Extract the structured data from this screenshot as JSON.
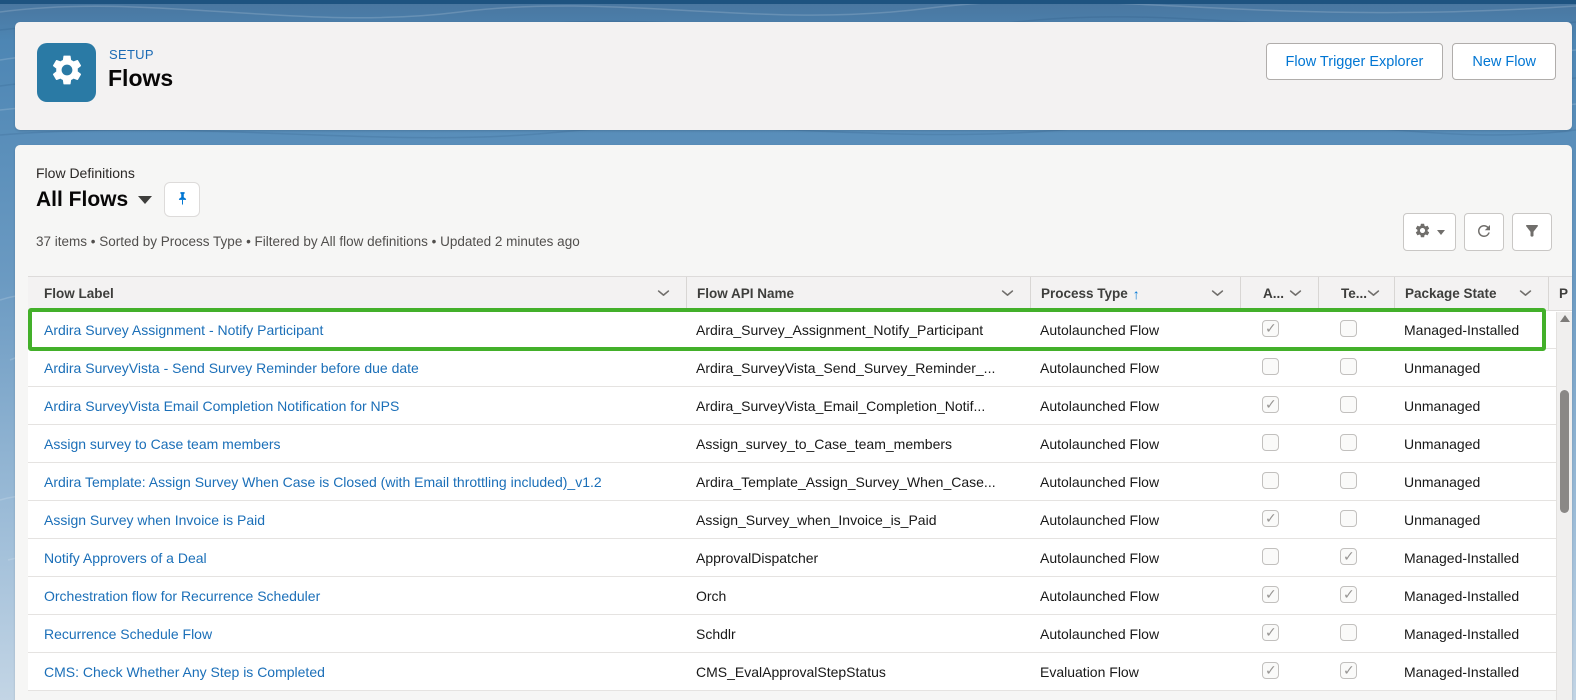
{
  "colors": {
    "tile": "#2a7aa5",
    "setuplabel": "#1b6bb5",
    "link": "#1b6fb8",
    "btn": "#0176d3",
    "green": "#43b02a"
  },
  "header": {
    "setup_label": "SETUP",
    "title": "Flows",
    "buttons": [
      {
        "label": "Flow Trigger Explorer"
      },
      {
        "label": "New Flow"
      }
    ],
    "icons": {
      "tile": "gear-icon"
    }
  },
  "list_header": {
    "entity_label": "Flow Definitions",
    "view_name": "All Flows",
    "status_text": "37 items • Sorted by Process Type • Filtered by All flow definitions • Updated 2 minutes ago",
    "icons": {
      "view_caret": "chevron-down-icon",
      "pin": "pin-icon",
      "settings": "gear-icon",
      "refresh": "refresh-icon",
      "filter": "filter-icon"
    }
  },
  "table": {
    "columns": [
      {
        "label": "Flow Label"
      },
      {
        "label": "Flow API Name"
      },
      {
        "label": "Process Type",
        "sorted": "ascending"
      },
      {
        "label": "A..."
      },
      {
        "label": "Te..."
      },
      {
        "label": "Package State"
      },
      {
        "label": "P",
        "clipped": true
      }
    ],
    "rows": [
      {
        "label": "Ardira Survey Assignment - Notify Participant",
        "api_name": "Ardira_Survey_Assignment_Notify_Participant",
        "process_type": "Autolaunched Flow",
        "active": true,
        "template": false,
        "package_state": "Managed-Installed",
        "highlighted": true
      },
      {
        "label": "Ardira SurveyVista - Send Survey Reminder before due date",
        "api_name": "Ardira_SurveyVista_Send_Survey_Reminder_...",
        "process_type": "Autolaunched Flow",
        "active": false,
        "template": false,
        "package_state": "Unmanaged"
      },
      {
        "label": "Ardira SurveyVista Email Completion Notification for NPS",
        "api_name": "Ardira_SurveyVista_Email_Completion_Notif...",
        "process_type": "Autolaunched Flow",
        "active": true,
        "template": false,
        "package_state": "Unmanaged"
      },
      {
        "label": "Assign survey to Case team members",
        "api_name": "Assign_survey_to_Case_team_members",
        "process_type": "Autolaunched Flow",
        "active": false,
        "template": false,
        "package_state": "Unmanaged"
      },
      {
        "label": "Ardira Template: Assign Survey When Case is Closed (with Email throttling included)_v1.2",
        "api_name": "Ardira_Template_Assign_Survey_When_Case...",
        "process_type": "Autolaunched Flow",
        "active": false,
        "template": false,
        "package_state": "Unmanaged"
      },
      {
        "label": "Assign Survey when Invoice is Paid",
        "api_name": "Assign_Survey_when_Invoice_is_Paid",
        "process_type": "Autolaunched Flow",
        "active": true,
        "template": false,
        "package_state": "Unmanaged"
      },
      {
        "label": "Notify Approvers of a Deal",
        "api_name": "ApprovalDispatcher",
        "process_type": "Autolaunched Flow",
        "active": false,
        "template": true,
        "package_state": "Managed-Installed"
      },
      {
        "label": "Orchestration flow for Recurrence Scheduler",
        "api_name": "Orch",
        "process_type": "Autolaunched Flow",
        "active": true,
        "template": true,
        "package_state": "Managed-Installed"
      },
      {
        "label": "Recurrence Schedule Flow",
        "api_name": "Schdlr",
        "process_type": "Autolaunched Flow",
        "active": true,
        "template": false,
        "package_state": "Managed-Installed"
      },
      {
        "label": "CMS: Check Whether Any Step is Completed",
        "api_name": "CMS_EvalApprovalStepStatus",
        "process_type": "Evaluation Flow",
        "active": true,
        "template": true,
        "package_state": "Managed-Installed"
      }
    ]
  }
}
